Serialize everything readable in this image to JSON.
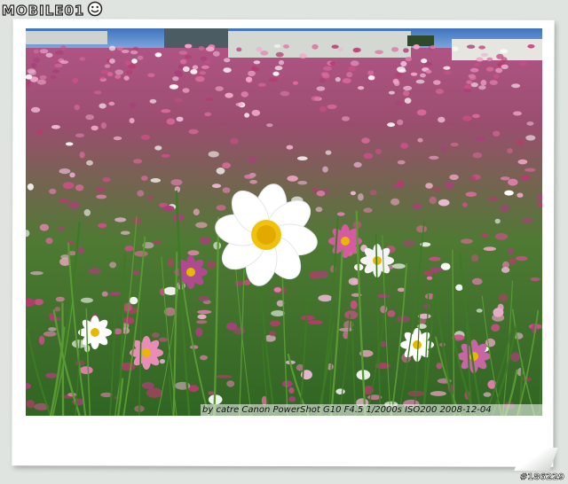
{
  "site_logo": {
    "text": "MOBILE01",
    "icon": "smiley-face-icon",
    "colors": {
      "fill": "#ffffff",
      "outline": "#222222"
    }
  },
  "photo": {
    "caption": "by   catre   Canon PowerShot  G10 F4.5  1/2000s  ISO200   2008-12-04",
    "subject": "cosmos-flower-field-icon",
    "colors": {
      "sky": "#4f82c8",
      "field": "#3f7a2a",
      "blossom_pink": "#d9679b",
      "blossom_white": "#ffffff",
      "center": "#f2c400"
    }
  },
  "watermark": "#186229"
}
